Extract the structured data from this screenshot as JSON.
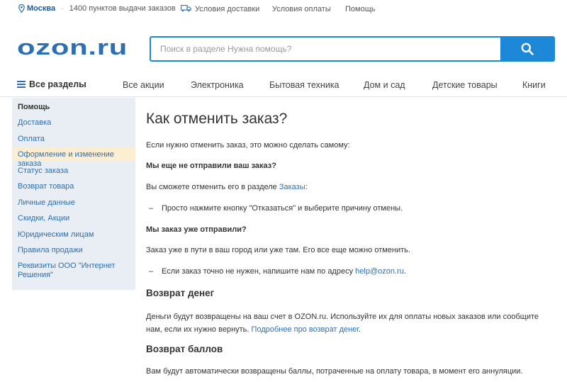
{
  "topbar": {
    "city": "Москва",
    "pickup_points": "1400 пунктов выдачи заказов",
    "delivery": "Условия доставки",
    "payment": "Условия оплаты",
    "help": "Помощь"
  },
  "header": {
    "logo": "OZON.ru",
    "search_placeholder": "Поиск в разделе Нужна помощь?"
  },
  "nav": {
    "all": "Все разделы",
    "items": [
      "Все акции",
      "Электроника",
      "Бытовая техника",
      "Дом и сад",
      "Детские товары",
      "Книги"
    ]
  },
  "sidebar": {
    "title": "Помощь",
    "items": [
      "Доставка",
      "Оплата",
      "Оформление и изменение заказа",
      "Статус заказа",
      "Возврат товара",
      "Личные данные",
      "Скидки, Акции",
      "Юридическим лицам",
      "Правила продажи",
      "Реквизиты ООО \"Интернет",
      "Решения\""
    ]
  },
  "content": {
    "title": "Как отменить заказ?",
    "intro": "Если нужно отменить заказ, это можно сделать самому:",
    "q1": "Мы еще не отправили ваш заказ?",
    "p1_text": "Вы сможете отменить его в разделе ",
    "p1_link": "Заказы",
    "p1_end": ":",
    "li1": "Просто нажмите кнопку \"Отказаться\" и выберите причину отмены.",
    "q2": "Мы заказ уже отправили?",
    "p2": "Заказ уже в пути в ваш город или уже там. Его все еще можно отменить.",
    "li2_text": "Если заказ точно не нужен, напишите нам по адресу ",
    "li2_link": "help@ozon.ru",
    "li2_end": ".",
    "h_refund": "Возврат денег",
    "refund_text": "Деньги будут возвращены на ваш счет в OZON.ru. Используйте их для оплаты новых заказов или сообщите нам, если их нужно вернуть. ",
    "refund_link": "Подробнее про возврат денег",
    "refund_end": ".",
    "h_points": "Возврат баллов",
    "points_text": "Вам будут автоматически возвращены баллы, потраченные на оплату товара, в момент его аннуляции."
  }
}
